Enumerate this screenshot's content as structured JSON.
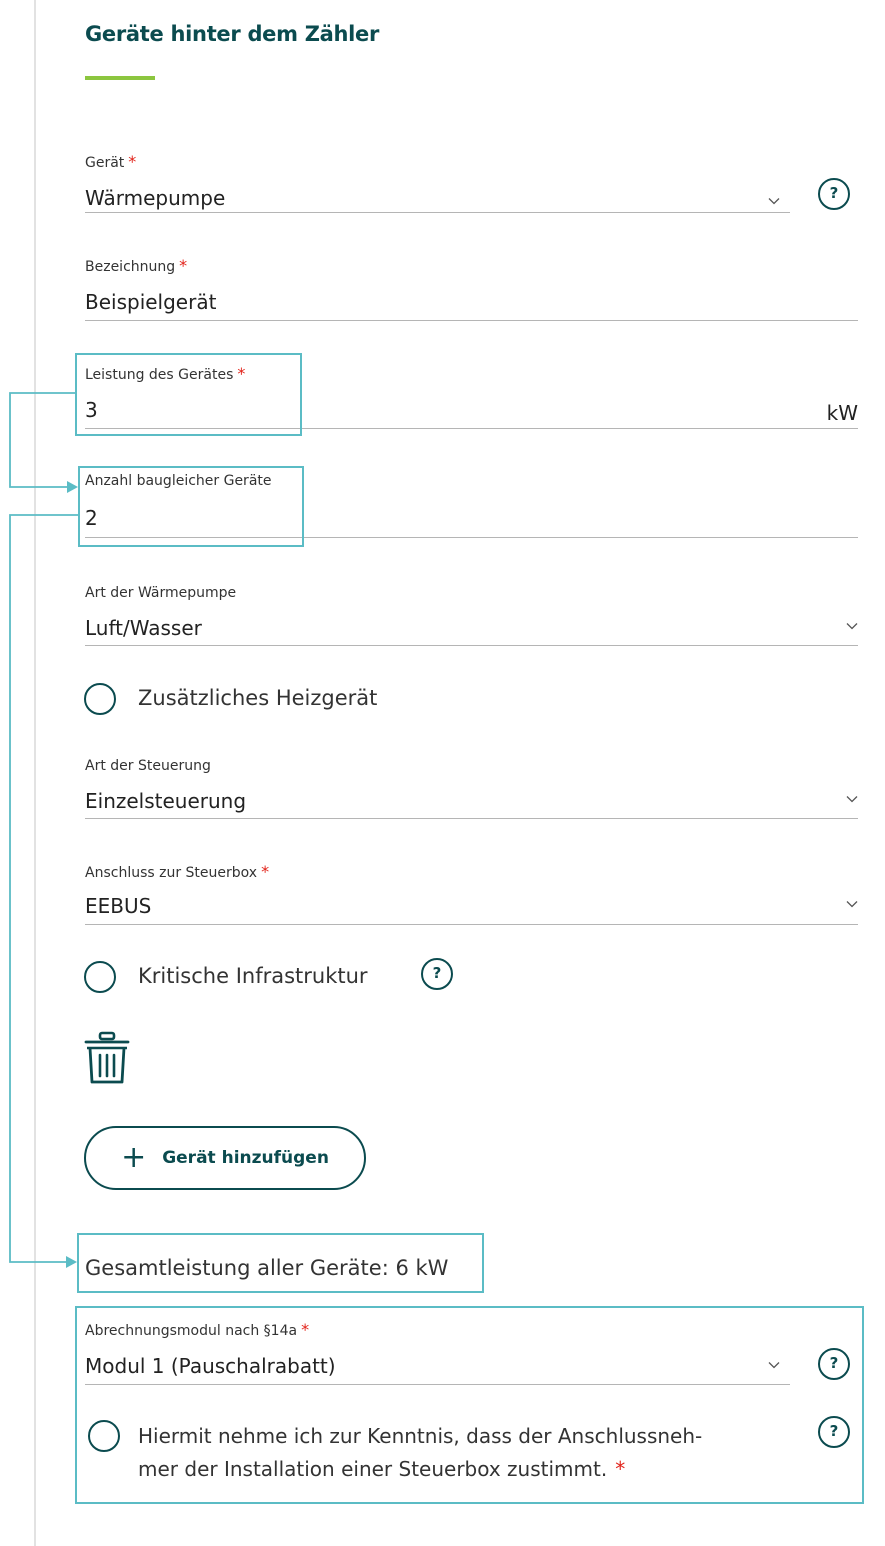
{
  "title": "Geräte hinter dem Zähler",
  "required_mark": "*",
  "help_glyph": "?",
  "fields": {
    "geraet": {
      "label": "Gerät",
      "value": "Wärmepumpe",
      "required": true
    },
    "bezeichnung": {
      "label": "Bezeichnung",
      "value": "Beispielgerät",
      "required": true
    },
    "leistung": {
      "label": "Leistung des Gerätes",
      "value": "3",
      "unit": "kW",
      "required": true
    },
    "anzahl": {
      "label": "Anzahl baugleicher Geräte",
      "value": "2",
      "required": false
    },
    "art_waermepumpe": {
      "label": "Art der Wärmepumpe",
      "value": "Luft/Wasser",
      "required": false
    },
    "art_steuerung": {
      "label": "Art der Steuerung",
      "value": "Einzelsteuerung",
      "required": false
    },
    "anschluss": {
      "label": "Anschluss zur Steuerbox",
      "value": "EEBUS",
      "required": true
    },
    "abrechnungsmodul": {
      "label": "Abrechnungsmodul nach §14a",
      "value": "Modul 1 (Pauschalrabatt)",
      "required": true
    }
  },
  "options": {
    "zusatz_heizgeraet": "Zusätzliches Heizgerät",
    "kritische_infrastruktur": "Kritische Infrastruktur",
    "consent_line1": "Hiermit nehme ich zur Kenntnis, dass der Anschlussneh-",
    "consent_line2": "mer der Installation einer Steuerbox zustimmt."
  },
  "add_button": {
    "icon": "+",
    "label": "Gerät hinzufügen"
  },
  "total": "Gesamtleistung aller Geräte: 6 kW",
  "colors": {
    "primary": "#0b4b4f",
    "accent_green": "#8cc63f",
    "highlight": "#5bbcc5",
    "required": "#e2231a"
  },
  "icons": [
    "chevron-down-icon",
    "help-icon",
    "trash-icon",
    "plus-icon",
    "radio-icon"
  ]
}
